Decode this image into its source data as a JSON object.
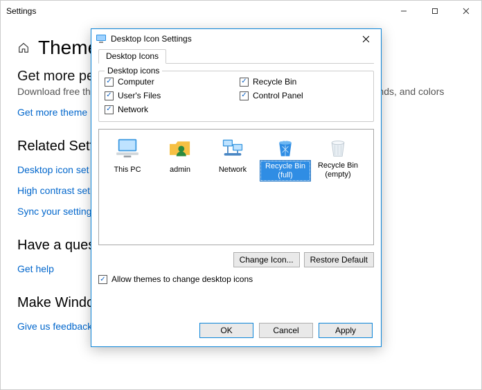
{
  "settings_window": {
    "title": "Settings",
    "breadcrumb_title": "Themes",
    "section_partial_heading": "Get more pe",
    "section_partial_desc": "Download free th",
    "section_partial_desc_tail": "unds, and colors",
    "get_more_themes": "Get more theme",
    "related_heading": "Related Setti",
    "links": {
      "desktop_icon": "Desktop icon set",
      "high_contrast": "High contrast set",
      "sync": "Sync your setting"
    },
    "question_heading": "Have a quest",
    "get_help": "Get help",
    "improve_heading": "Make Windows better",
    "feedback": "Give us feedback"
  },
  "dialog": {
    "title": "Desktop Icon Settings",
    "tab": "Desktop Icons",
    "group_legend": "Desktop icons",
    "checks": {
      "computer": "Computer",
      "recycle": "Recycle Bin",
      "users": "User's Files",
      "cpanel": "Control Panel",
      "network": "Network"
    },
    "icons": {
      "pc": "This PC",
      "admin": "admin",
      "net": "Network",
      "rb_full": "Recycle Bin (full)",
      "rb_empty": "Recycle Bin (empty)"
    },
    "change_icon": "Change Icon...",
    "restore_default": "Restore Default",
    "allow_themes": "Allow themes to change desktop icons",
    "ok": "OK",
    "cancel": "Cancel",
    "apply": "Apply"
  }
}
